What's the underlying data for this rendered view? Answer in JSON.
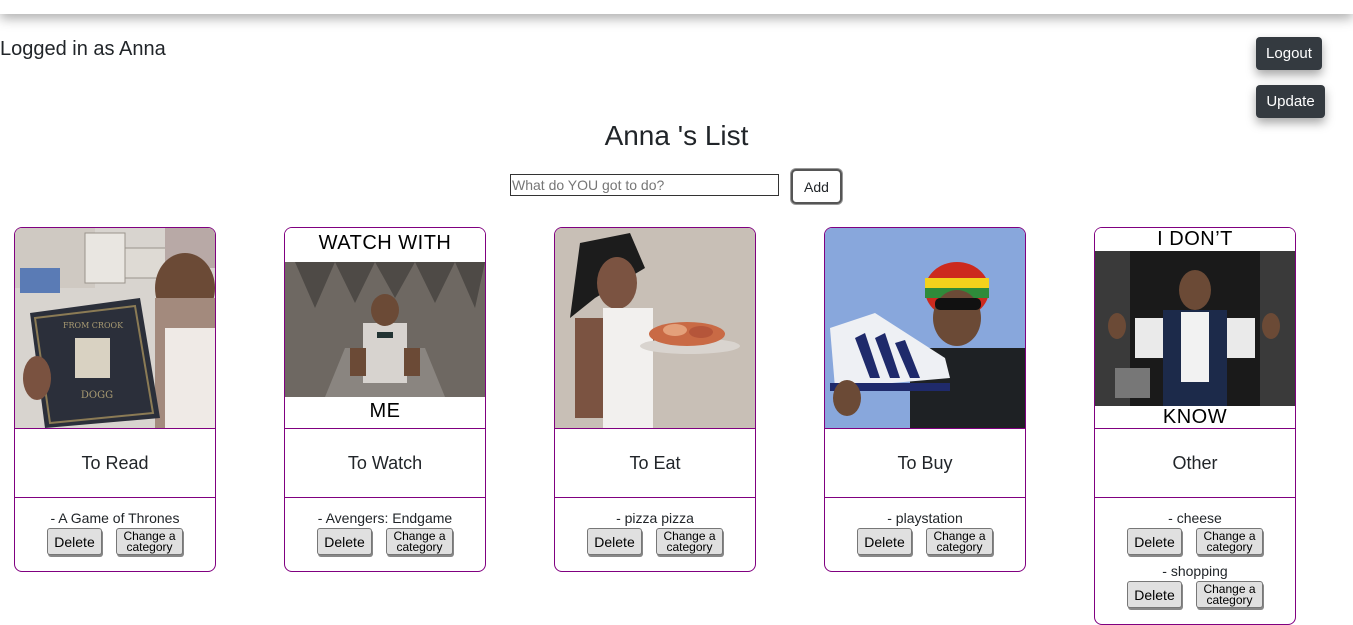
{
  "header": {
    "logged_in_text": "Logged in as Anna"
  },
  "buttons": {
    "logout": "Logout",
    "update": "Update"
  },
  "list": {
    "title": "Anna 's List",
    "input_placeholder": "What do YOU got to do?",
    "add_label": "Add"
  },
  "item_buttons": {
    "delete": "Delete",
    "change_line1": "Change a",
    "change_line2": "category"
  },
  "categories": [
    {
      "name": "To Read",
      "items": [
        "- A Game of Thrones"
      ]
    },
    {
      "name": "To Watch",
      "meme_top": "WATCH WITH",
      "meme_bottom": "ME",
      "items": [
        "- Avengers: Endgame"
      ]
    },
    {
      "name": "To Eat",
      "items": [
        "- pizza pizza"
      ]
    },
    {
      "name": "To Buy",
      "items": [
        "- playstation"
      ]
    },
    {
      "name": "Other",
      "meme_top": "I DON’T",
      "meme_bottom": "KNOW",
      "items": [
        "- cheese",
        "- shopping"
      ]
    }
  ]
}
